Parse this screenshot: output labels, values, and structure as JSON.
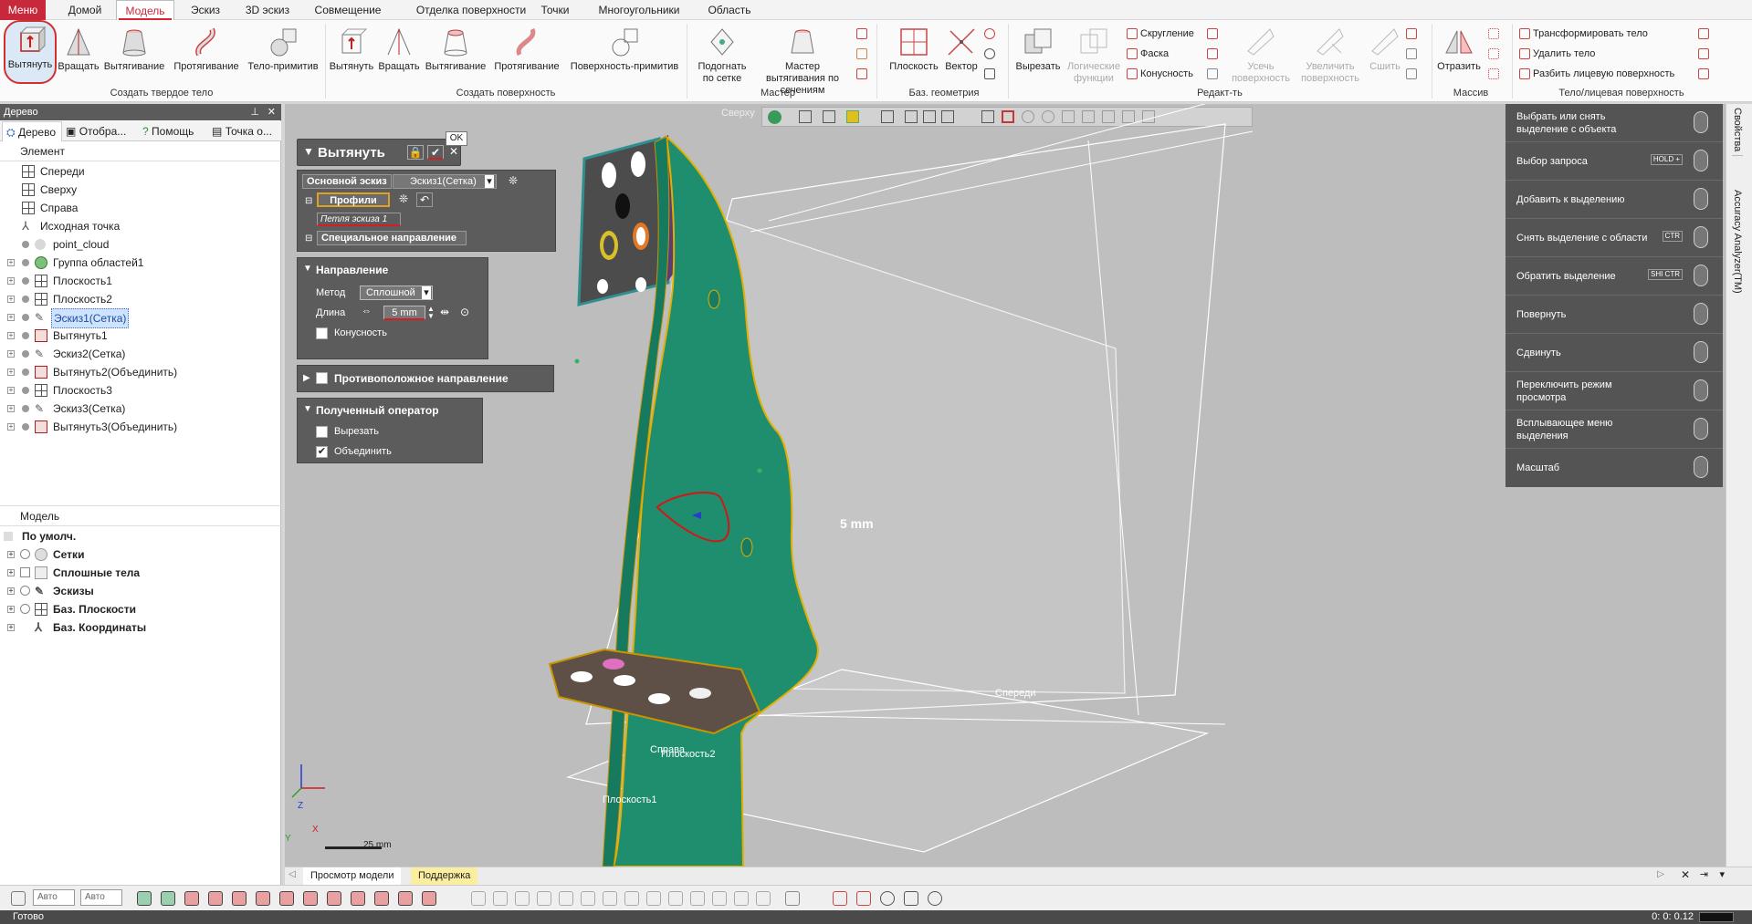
{
  "menu_tabs": [
    "Меню",
    "Домой",
    "Модель",
    "Эскиз",
    "3D эскиз",
    "Совмещение",
    "Отделка поверхности",
    "Точки",
    "Многоугольники",
    "Область"
  ],
  "ribbon": {
    "solid_buttons": [
      "Вытянуть",
      "Вращать",
      "Вытягивание",
      "Протягивание",
      "Тело-примитив"
    ],
    "solid_group": "Создать твердое тело",
    "surface_buttons": [
      "Вытянуть",
      "Вращать",
      "Вытягивание",
      "Протягивание",
      "Поверхность-примитив"
    ],
    "surface_group": "Создать поверхность",
    "wizard_buttons": [
      "Подогнать по сетке",
      "Мастер вытягивания по сечениям"
    ],
    "wizard_group": "Мастер",
    "refgeom_buttons": [
      "Плоскость",
      "Вектор"
    ],
    "refgeom_group": "Баз. геометрия",
    "edit_buttons": [
      "Вырезать",
      "Логические функции",
      "Усечь поверхность",
      "Увеличить поверхность",
      "Сшить"
    ],
    "edit_small": [
      "Скругление",
      "Фаска",
      "Конусность"
    ],
    "edit_group": "Редакт-ть",
    "pattern_buttons": [
      "Отразить"
    ],
    "pattern_group": "Массив",
    "body_small": [
      "Трансформировать тело",
      "Удалить тело",
      "Разбить лицевую поверхность"
    ],
    "body_group": "Тело/лицевая поверхность"
  },
  "tree": {
    "title": "Дерево",
    "tabs": [
      "Дерево",
      "Отобра...",
      "Помощь",
      "Точка о..."
    ],
    "column_header": "Элемент",
    "items": [
      "Спереди",
      "Сверху",
      "Справа",
      "Исходная точка",
      "point_cloud",
      "Группа областей1",
      "Плоскость1",
      "Плоскость2",
      "Эскиз1(Сетка)",
      "Вытянуть1",
      "Эскиз2(Сетка)",
      "Вытянуть2(Объединить)",
      "Плоскость3",
      "Эскиз3(Сетка)",
      "Вытянуть3(Объединить)"
    ],
    "model_header": "Модель",
    "model_items": [
      "По умолч.",
      "Сетки",
      "Сплошные тела",
      "Эскизы",
      "Баз. Плоскости",
      "Баз. Координаты"
    ]
  },
  "operation": {
    "title": "Вытянуть",
    "ok_tooltip": "OK",
    "base_sketch_label": "Основной эскиз",
    "base_sketch_value": "Эскиз1(Сетка)",
    "profiles_label": "Профили",
    "profile_item": "Петля эскиза 1",
    "special_direction": "Специальное направление",
    "direction_title": "Направление",
    "method_label": "Метод",
    "method_value": "Сплошной",
    "length_label": "Длина",
    "length_value": "5 mm",
    "taper_label": "Конусность",
    "opposite_title": "Противоположное направление",
    "result_title": "Полученный оператор",
    "cut_label": "Вырезать",
    "merge_label": "Объединить"
  },
  "viewport": {
    "view_labels": [
      "Сверху",
      "Справа",
      "Спереди",
      "Плоскость1",
      "Плоскость2"
    ],
    "dimension_label": "5 mm",
    "scale_label": "25 mm",
    "accent_green": "#1f8e6e"
  },
  "mouse_help": [
    {
      "text": "Выбрать или снять выделение с объекта",
      "key": ""
    },
    {
      "text": "Выбор запроса",
      "key": "HOLD +"
    },
    {
      "text": "Добавить к выделению",
      "key": ""
    },
    {
      "text": "Снять выделение с области",
      "key": "CTR"
    },
    {
      "text": "Обратить выделение",
      "key": "SHI CTR"
    },
    {
      "text": "Повернуть",
      "key": ""
    },
    {
      "text": "Сдвинуть",
      "key": ""
    },
    {
      "text": "Переключить режим просмотра",
      "key": ""
    },
    {
      "text": "Всплывающее меню выделения",
      "key": ""
    },
    {
      "text": "Масштаб",
      "key": ""
    }
  ],
  "right_strip": [
    "Свойства",
    "Accuracy Analyzer(TM)"
  ],
  "bottom_tabs": [
    "Просмотр модели",
    "Поддержка"
  ],
  "bottom_toolbar": {
    "select1": "Авто",
    "select2": "Авто"
  },
  "status": {
    "text": "Готово",
    "time": "0: 0: 0.12"
  }
}
